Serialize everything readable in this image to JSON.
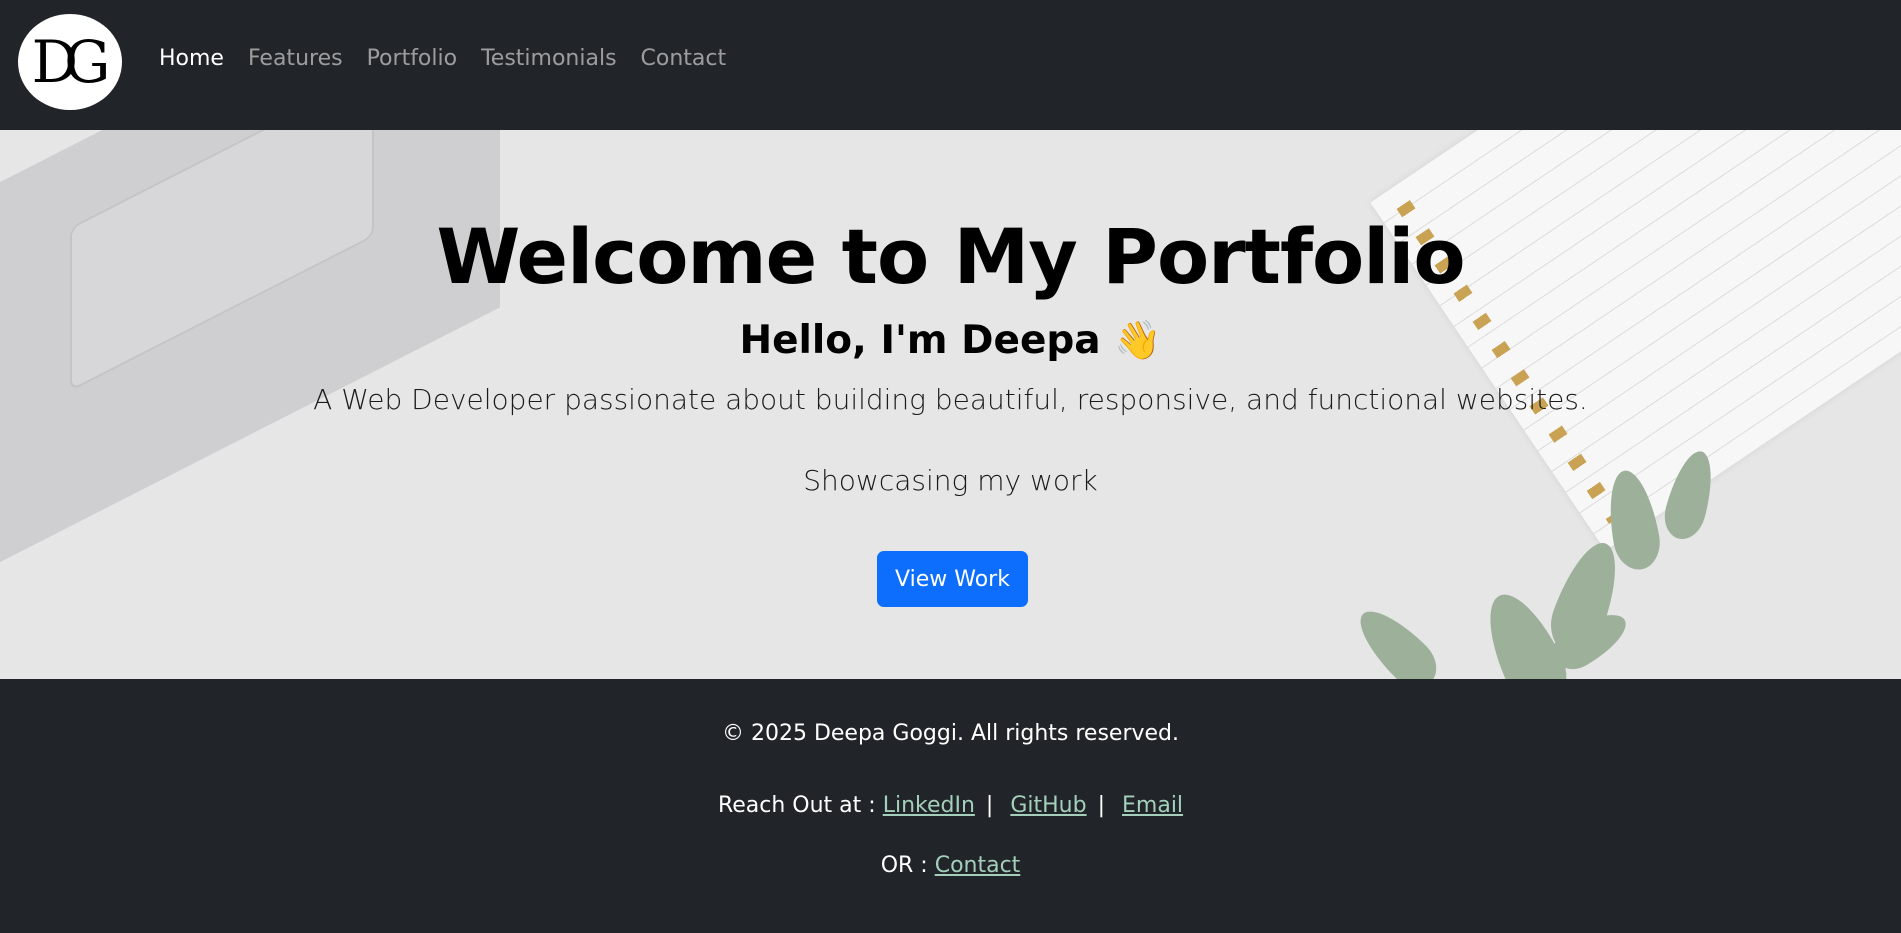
{
  "nav": {
    "logo_text": "DG",
    "links": [
      "Home",
      "Features",
      "Portfolio",
      "Testimonials",
      "Contact"
    ]
  },
  "hero": {
    "title": "Welcome to My Portfolio",
    "hello": "Hello, I'm Deepa",
    "wave": "👋",
    "tagline": "A Web Developer passionate about building beautiful, responsive, and functional websites.",
    "showcase": "Showcasing my work",
    "button_label": "View Work"
  },
  "footer": {
    "copyright": "© 2025 Deepa Goggi. All rights reserved.",
    "reach_out_label": "Reach Out at :",
    "linkedin": "LinkedIn",
    "github": "GitHub",
    "email": "Email",
    "separator": "|",
    "or_label": "OR :",
    "contact": "Contact"
  },
  "colors": {
    "navbar_bg": "#212529",
    "primary_button": "#0d6efd",
    "footer_link": "#a3cfbb"
  }
}
